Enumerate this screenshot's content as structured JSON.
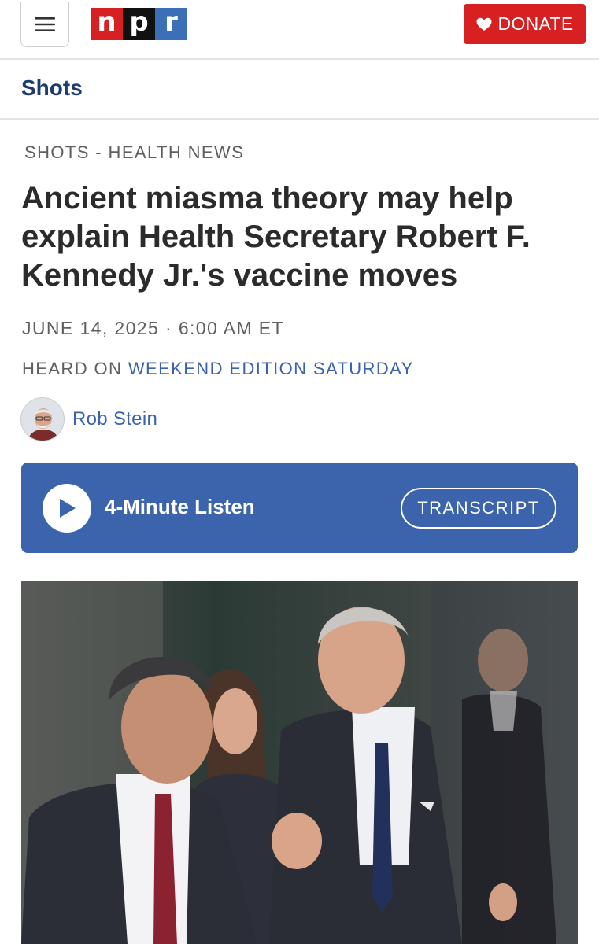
{
  "header": {
    "logo_letters": [
      "n",
      "p",
      "r"
    ],
    "donate_label": "DONATE"
  },
  "section": {
    "title": "Shots"
  },
  "article": {
    "eyebrow": "SHOTS - HEALTH NEWS",
    "headline": "Ancient miasma theory may help explain Health Secretary Robert F. Kennedy Jr.'s vaccine moves",
    "dateline": "JUNE 14, 2025 · 6:00 AM ET",
    "heard_on_prefix": "HEARD ON",
    "heard_on_show": "WEEKEND EDITION SATURDAY",
    "author": "Rob Stein"
  },
  "player": {
    "listen_label": "4-Minute Listen",
    "transcript_label": "TRANSCRIPT"
  },
  "colors": {
    "npr_red": "#d62021",
    "npr_blue": "#3b6fb6",
    "player_blue": "#3c64ad",
    "link_blue": "#3a62ad",
    "section_navy": "#1d3c6e"
  },
  "icons": {
    "menu": "hamburger-menu-icon",
    "donate": "heart-icon",
    "play": "play-icon"
  }
}
